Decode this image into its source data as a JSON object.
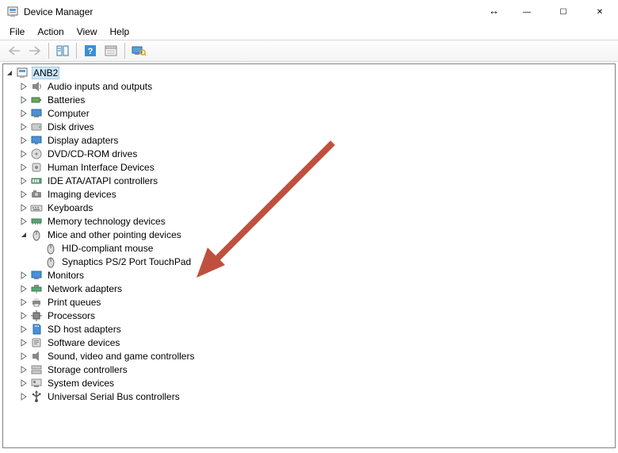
{
  "window": {
    "title": "Device Manager",
    "minimize_glyph": "—",
    "maximize_glyph": "☐",
    "close_glyph": "✕"
  },
  "menu": {
    "file": "File",
    "action": "Action",
    "view": "View",
    "help": "Help"
  },
  "root": {
    "label": "ANB2"
  },
  "categories": [
    {
      "label": "Audio inputs and outputs",
      "icon": "audio"
    },
    {
      "label": "Batteries",
      "icon": "battery"
    },
    {
      "label": "Computer",
      "icon": "computer"
    },
    {
      "label": "Disk drives",
      "icon": "disk"
    },
    {
      "label": "Display adapters",
      "icon": "display"
    },
    {
      "label": "DVD/CD-ROM drives",
      "icon": "optical"
    },
    {
      "label": "Human Interface Devices",
      "icon": "hid"
    },
    {
      "label": "IDE ATA/ATAPI controllers",
      "icon": "ide"
    },
    {
      "label": "Imaging devices",
      "icon": "imaging"
    },
    {
      "label": "Keyboards",
      "icon": "keyboard"
    },
    {
      "label": "Memory technology devices",
      "icon": "memory"
    },
    {
      "label": "Mice and other pointing devices",
      "icon": "mouse",
      "expanded": true,
      "children": [
        {
          "label": "HID-compliant mouse",
          "icon": "mouse"
        },
        {
          "label": "Synaptics PS/2 Port TouchPad",
          "icon": "mouse"
        }
      ]
    },
    {
      "label": "Monitors",
      "icon": "monitor"
    },
    {
      "label": "Network adapters",
      "icon": "network"
    },
    {
      "label": "Print queues",
      "icon": "printer"
    },
    {
      "label": "Processors",
      "icon": "cpu"
    },
    {
      "label": "SD host adapters",
      "icon": "sd"
    },
    {
      "label": "Software devices",
      "icon": "software"
    },
    {
      "label": "Sound, video and game controllers",
      "icon": "sound"
    },
    {
      "label": "Storage controllers",
      "icon": "storage"
    },
    {
      "label": "System devices",
      "icon": "system"
    },
    {
      "label": "Universal Serial Bus controllers",
      "icon": "usb"
    }
  ]
}
